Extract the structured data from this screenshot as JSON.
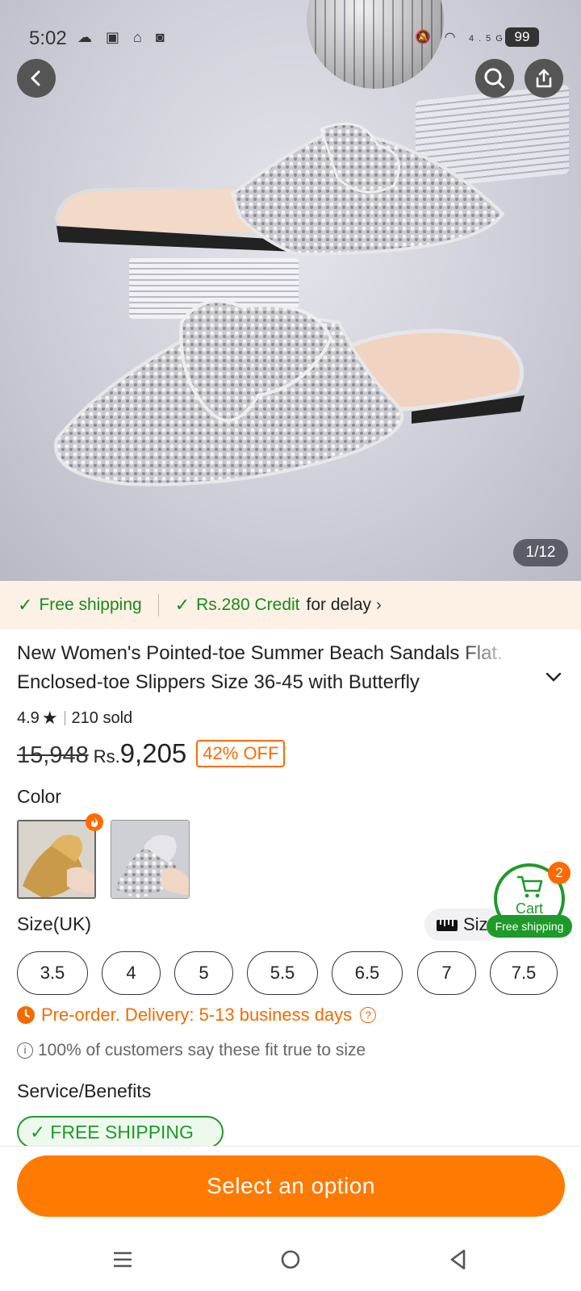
{
  "status_bar": {
    "time": "5:02",
    "net1": "4.5G",
    "net2": "4G",
    "battery": "99"
  },
  "gallery": {
    "counter": "1/12"
  },
  "shipping_strip": {
    "free_shipping": "Free shipping",
    "credit": "Rs.280 Credit",
    "delay_text": "for delay"
  },
  "product": {
    "title": "New Women's Pointed-toe Summer Beach Sandals Flat. Enclosed-toe Slippers Size 36-45 with Butterfly",
    "rating": "4.9",
    "sold": "210 sold",
    "old_price": "15,948",
    "currency": "Rs.",
    "price": "9,205",
    "discount": "42% OFF"
  },
  "color": {
    "label": "Color",
    "options": [
      "gold",
      "silver"
    ]
  },
  "size": {
    "label": "Size(UK)",
    "guide_label": "Size",
    "options": [
      "3.5",
      "4",
      "5",
      "5.5",
      "6.5",
      "7",
      "7.5"
    ]
  },
  "cart": {
    "label": "Cart",
    "count": "2",
    "free_shipping": "Free shipping"
  },
  "preorder": {
    "text": "Pre-order. Delivery: 5-13 business days"
  },
  "fit_note": {
    "text": "100% of customers say these fit true to size"
  },
  "service": {
    "label": "Service/Benefits",
    "badge": "FREE SHIPPING"
  },
  "cta": {
    "label": "Select an option"
  },
  "colors": {
    "accent": "#ff7a00",
    "green": "#1e9a2a",
    "strip_bg": "#fdf1e6"
  }
}
